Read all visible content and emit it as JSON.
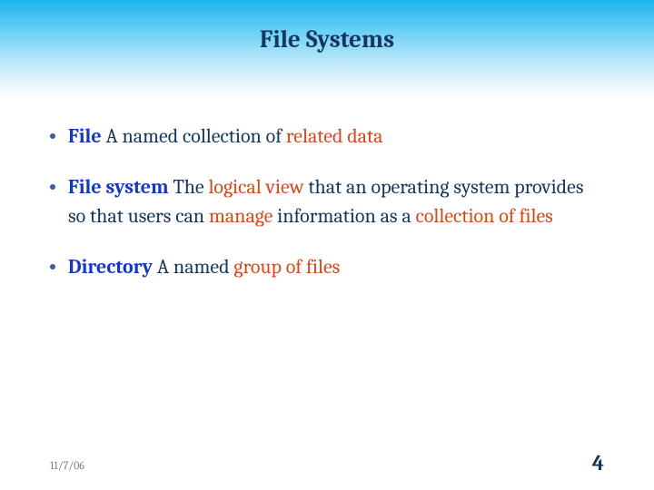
{
  "title": "File Systems",
  "bullets": [
    {
      "term": "File",
      "parts": [
        {
          "text": "   A named collection of ",
          "accent": false
        },
        {
          "text": "related data",
          "accent": true
        }
      ]
    },
    {
      "term": "File system",
      "parts": [
        {
          "text": "   The ",
          "accent": false
        },
        {
          "text": "logical view",
          "accent": true
        },
        {
          "text": " that an operating system provides so that users can ",
          "accent": false
        },
        {
          "text": "manage",
          "accent": true
        },
        {
          "text": " information as a ",
          "accent": false
        },
        {
          "text": "collection of files",
          "accent": true
        }
      ]
    },
    {
      "term": "Directory",
      "parts": [
        {
          "text": "  A named ",
          "accent": false
        },
        {
          "text": "group of files",
          "accent": true
        }
      ]
    }
  ],
  "footer": {
    "date": "11/7/06",
    "page": "4"
  }
}
